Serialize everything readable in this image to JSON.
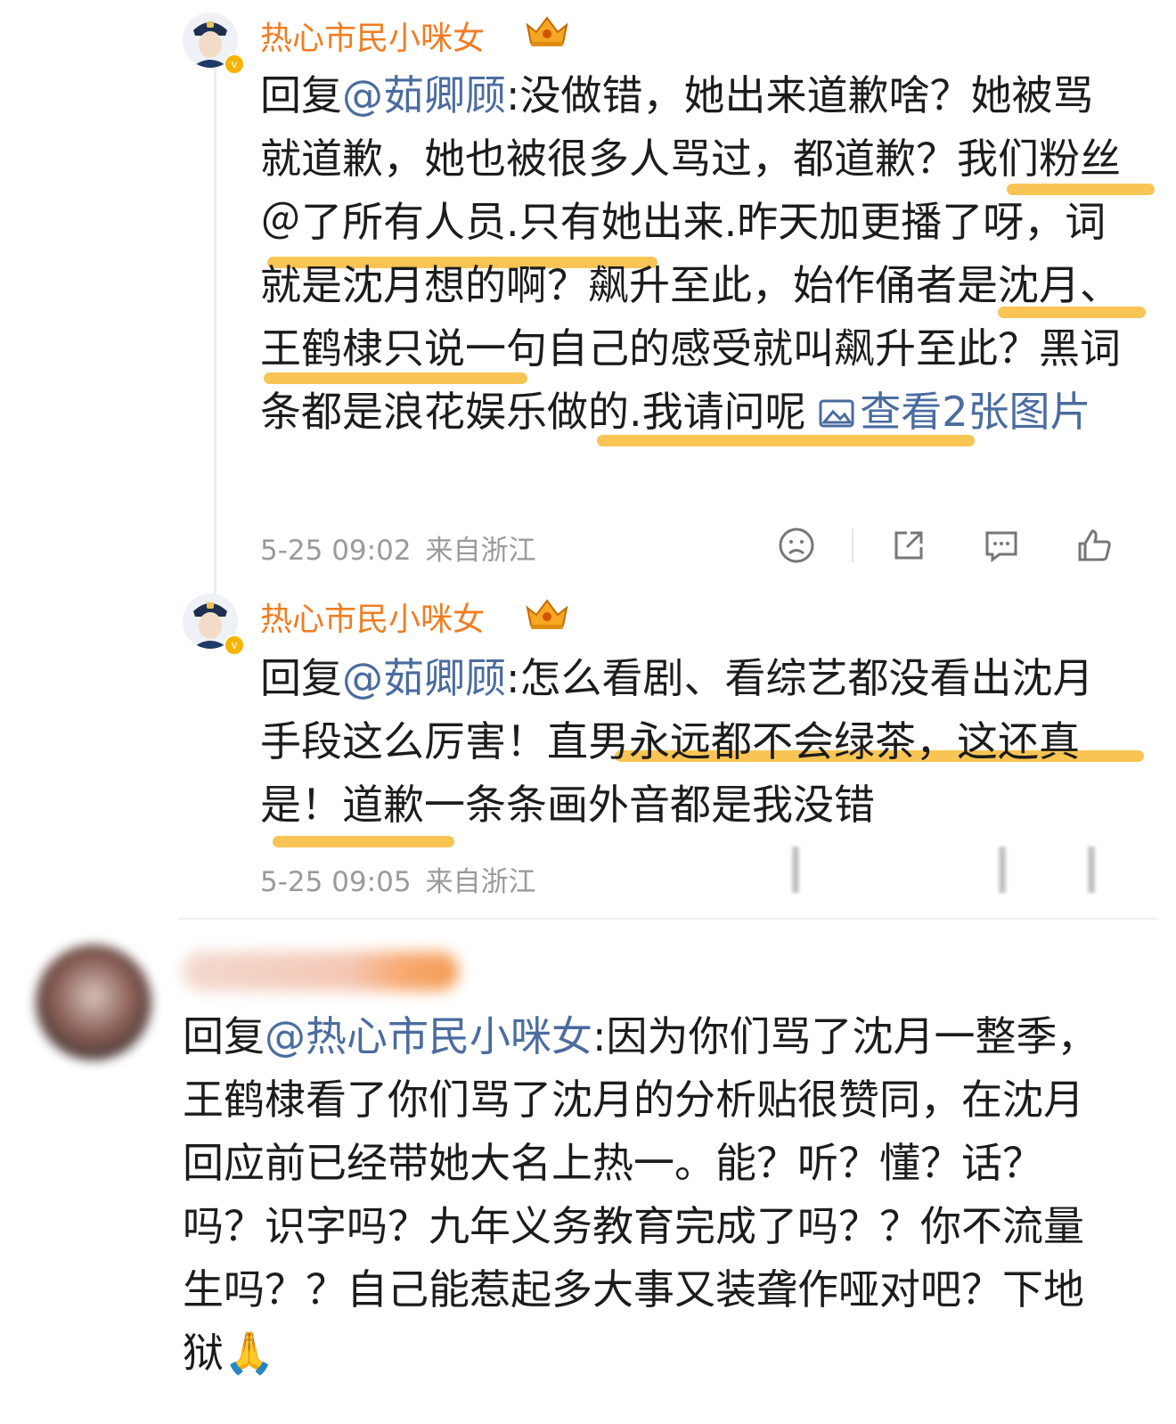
{
  "comments": [
    {
      "username": "热心市民小咪女",
      "reply_prefix": "回复",
      "mention": "@茹卿顾",
      "text": ":没做错，她出来道歉啥？她被骂就道歉，她也被很多人骂过，都道歉？我们粉丝＠了所有人员.只有她出来.昨天加更播了呀，词就是沈月想的啊？飙升至此，始作俑者是沈月、王鹤棣只说一句自己的感受就叫飙升至此？黑词条都是浪花娱乐做的.我请问呢",
      "image_link": "查看2张图片",
      "time": "5-25 09:02",
      "location": "来自浙江"
    },
    {
      "username": "热心市民小咪女",
      "reply_prefix": "回复",
      "mention": "@茹卿顾",
      "text": ":怎么看剧、看综艺都没看出沈月手段这么厉害！直男永远都不会绿茶，这还真是！道歉一条条画外音都是我没错",
      "time": "5-25 09:05",
      "location": "来自浙江"
    },
    {
      "reply_prefix": "回复",
      "mention": "@热心市民小咪女",
      "text": ":因为你们骂了沈月一整季，王鹤棣看了你们骂了沈月的分析贴很赞同，在沈月回应前已经带她大名上热一。能？听？懂？话？吗？识字吗？九年义务教育完成了吗？？你不流量生吗？？自己能惹起多大事又装聋作哑对吧？下地狱",
      "emoji": "🙏"
    }
  ],
  "icons": {
    "dislike": "sad-face-icon",
    "share": "share-icon",
    "comment": "comment-icon",
    "like": "thumbs-up-icon",
    "crown": "crown-badge-icon",
    "image": "image-icon"
  },
  "colors": {
    "username": "#f07d23",
    "mention": "#4a6c9f",
    "highlight": "#f7c046",
    "meta": "#9a9a9a"
  }
}
